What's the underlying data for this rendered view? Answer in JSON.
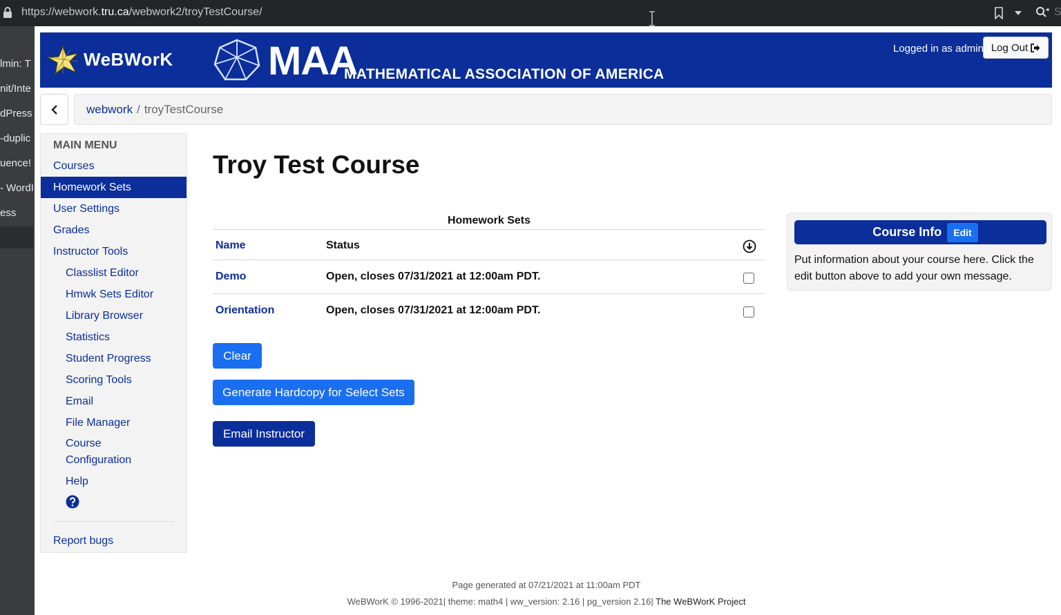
{
  "browser": {
    "url_prefix": "https://webwork.",
    "url_domain": "tru.ca",
    "url_path": "/webwork2/troyTestCourse/",
    "side_tabs": [
      "lmin: T",
      "nit/Inte",
      "dPress",
      "-duplic",
      "uence!",
      "- WordI",
      "ess",
      ""
    ],
    "search_shortcut": "S"
  },
  "header": {
    "webwork_logo": "WeBWorK",
    "maa_big": "MAA",
    "maa_small": "MATHEMATICAL ASSOCIATION OF AMERICA",
    "logged_in": "Logged in as admin.",
    "logout_label": "Log Out"
  },
  "breadcrumb": {
    "root": "webwork",
    "sep": "/",
    "current": "troyTestCourse"
  },
  "menu": {
    "title": "MAIN MENU",
    "items": {
      "courses": "Courses",
      "homework_sets": "Homework Sets",
      "user_settings": "User Settings",
      "grades": "Grades",
      "instructor_tools": "Instructor Tools",
      "classlist_editor": "Classlist Editor",
      "hmwk_sets_editor": "Hmwk Sets Editor",
      "library_browser": "Library Browser",
      "statistics": "Statistics",
      "student_progress": "Student Progress",
      "scoring_tools": "Scoring Tools",
      "email": "Email",
      "file_manager": "File Manager",
      "course_configuration_1": "Course",
      "course_configuration_2": "Configuration",
      "help": "Help",
      "report_bugs": "Report bugs"
    }
  },
  "page": {
    "title": "Troy Test Course"
  },
  "homework": {
    "caption": "Homework Sets",
    "col_name": "Name",
    "col_status": "Status",
    "rows": [
      {
        "name": "Demo",
        "status": "Open, closes 07/31/2021 at 12:00am PDT."
      },
      {
        "name": "Orientation",
        "status": "Open, closes 07/31/2021 at 12:00am PDT."
      }
    ]
  },
  "buttons": {
    "clear": "Clear",
    "hardcopy": "Generate Hardcopy for Select Sets",
    "email_instructor": "Email Instructor"
  },
  "course_info": {
    "title": "Course Info",
    "edit": "Edit",
    "text": "Put information about your course here. Click the edit button above to add your own message."
  },
  "footer": {
    "generated": "Page generated at 07/21/2021 at 11:00am PDT",
    "versions": "WeBWorK © 1996-2021| theme: math4 | ww_version: 2.16 | pg_version 2.16|",
    "project": "The WeBWorK Project"
  },
  "colors": {
    "brand_blue": "#0b2e9a",
    "button_blue": "#1a6ff0"
  }
}
